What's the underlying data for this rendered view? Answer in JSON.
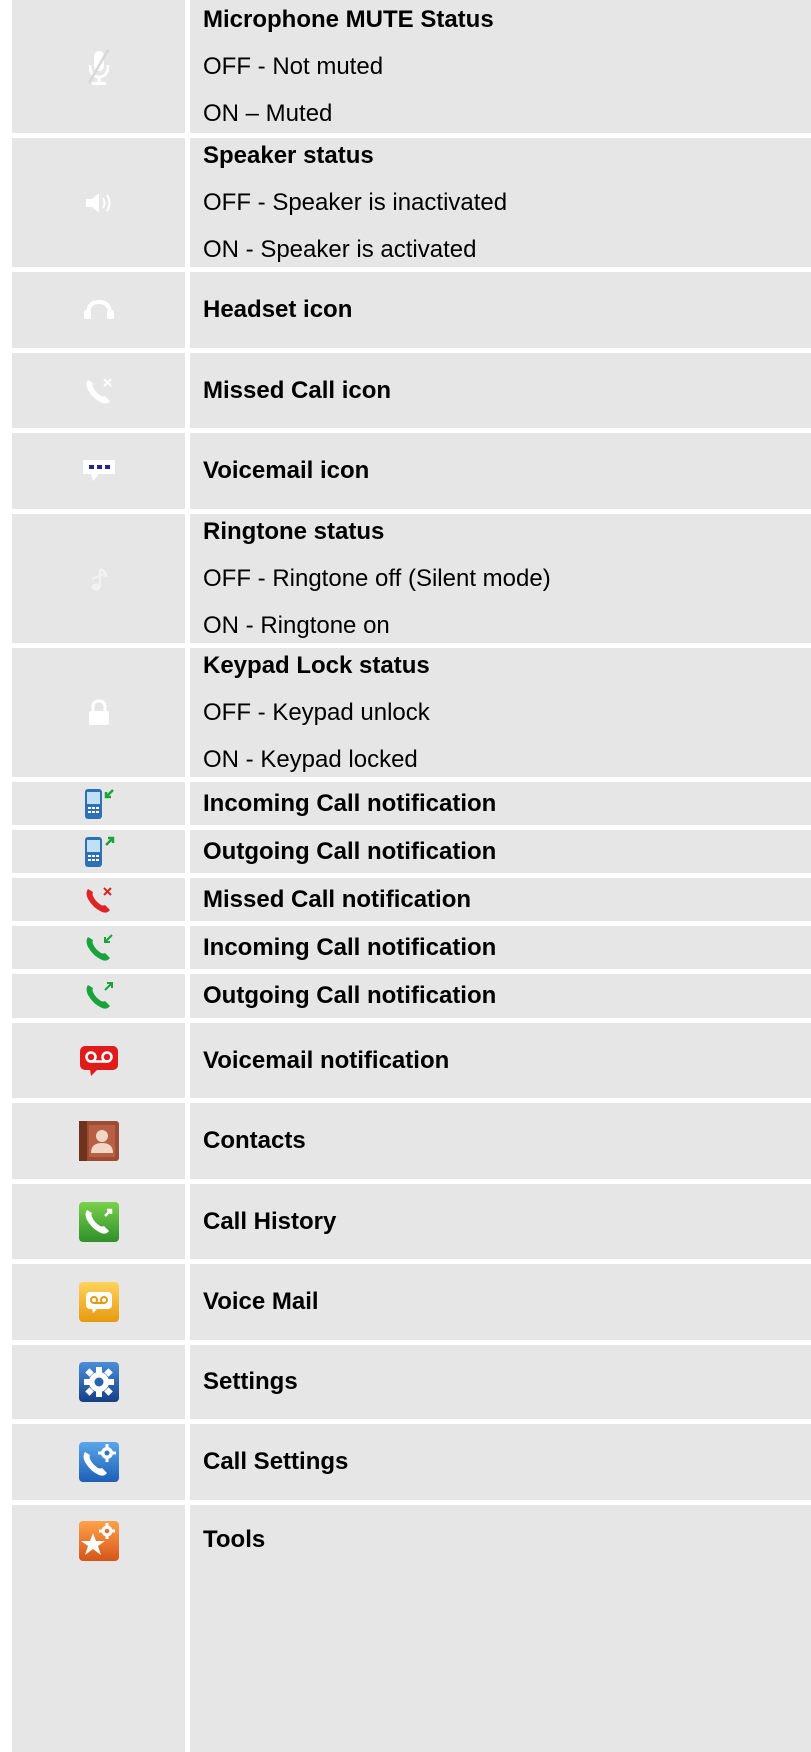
{
  "rows": [
    {
      "icon": "microphone-mute-icon",
      "title": "Microphone MUTE Status",
      "lines": [
        "OFF - Not muted",
        "ON – Muted"
      ]
    },
    {
      "icon": "speaker-icon",
      "title": "Speaker status",
      "lines": [
        "OFF - Speaker is inactivated",
        "ON - Speaker is activated"
      ]
    },
    {
      "icon": "headset-icon",
      "title": "Headset icon",
      "lines": []
    },
    {
      "icon": "missed-call-icon",
      "title": "Missed Call icon",
      "lines": []
    },
    {
      "icon": "voicemail-icon",
      "title": "Voicemail icon",
      "lines": []
    },
    {
      "icon": "ringtone-icon",
      "title": "Ringtone status",
      "lines": [
        "OFF - Ringtone off (Silent mode)",
        "ON - Ringtone on"
      ]
    },
    {
      "icon": "lock-icon",
      "title": "Keypad Lock status",
      "lines": [
        "OFF - Keypad unlock",
        "ON - Keypad locked"
      ]
    },
    {
      "icon": "incoming-call-phone-icon",
      "title": "Incoming Call notification",
      "lines": []
    },
    {
      "icon": "outgoing-call-phone-icon",
      "title": "Outgoing Call notification",
      "lines": []
    },
    {
      "icon": "missed-call-notification-icon",
      "title": "Missed Call notification",
      "lines": []
    },
    {
      "icon": "incoming-call-handset-icon",
      "title": "Incoming Call notification",
      "lines": []
    },
    {
      "icon": "outgoing-call-handset-icon",
      "title": "Outgoing Call notification",
      "lines": []
    },
    {
      "icon": "voicemail-notification-icon",
      "title": "Voicemail notification",
      "lines": []
    },
    {
      "icon": "contacts-icon",
      "title": "Contacts",
      "lines": []
    },
    {
      "icon": "call-history-icon",
      "title": "Call History",
      "lines": []
    },
    {
      "icon": "voice-mail-app-icon",
      "title": "Voice Mail",
      "lines": []
    },
    {
      "icon": "settings-icon",
      "title": "Settings",
      "lines": []
    },
    {
      "icon": "call-settings-icon",
      "title": "Call Settings",
      "lines": []
    },
    {
      "icon": "tools-icon",
      "title": "Tools",
      "lines": []
    }
  ]
}
